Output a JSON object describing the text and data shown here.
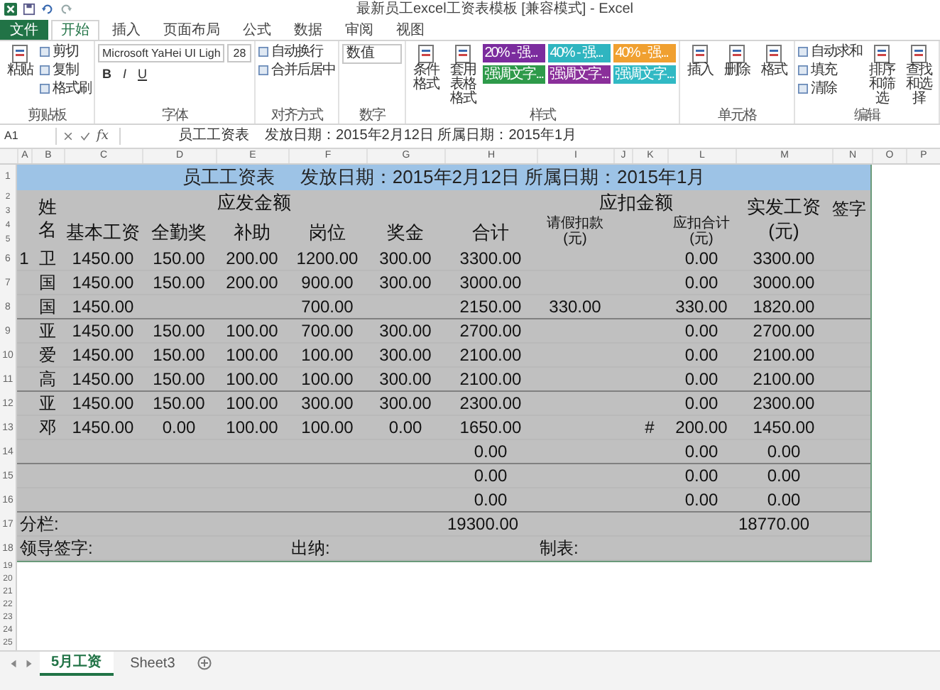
{
  "window": {
    "title": "最新员工excel工资表模板 [兼容模式] - Excel"
  },
  "ribbon": {
    "tabs": [
      {
        "label": "文件",
        "kind": "file",
        "selected": false
      },
      {
        "label": "开始",
        "kind": "tab",
        "selected": true
      },
      {
        "label": "插入",
        "kind": "tab",
        "selected": false
      },
      {
        "label": "页面布局",
        "kind": "tab",
        "selected": false
      },
      {
        "label": "公式",
        "kind": "tab",
        "selected": false
      },
      {
        "label": "数据",
        "kind": "tab",
        "selected": false
      },
      {
        "label": "审阅",
        "kind": "tab",
        "selected": false
      },
      {
        "label": "视图",
        "kind": "tab",
        "selected": false
      }
    ],
    "groups": [
      {
        "label": "剪贴板",
        "items": [
          {
            "kind": "big",
            "label": "粘贴"
          },
          {
            "kind": "stack",
            "labels": [
              "剪切",
              "复制",
              "格式刷"
            ]
          }
        ]
      },
      {
        "label": "字体",
        "items": [
          {
            "kind": "font",
            "font": "Microsoft YaHei UI Ligh",
            "size": "28",
            "glyphs": [
              "B",
              "I",
              "U"
            ]
          }
        ]
      },
      {
        "label": "对齐方式",
        "items": [
          {
            "kind": "stack",
            "labels": [
              "自动换行",
              "合并后居中"
            ]
          }
        ]
      },
      {
        "label": "数字",
        "items": [
          {
            "kind": "select",
            "value": "数值"
          }
        ]
      },
      {
        "label": "样式",
        "items": [
          {
            "kind": "big",
            "label": "条件格式"
          },
          {
            "kind": "big",
            "label": "套用表格格式"
          },
          {
            "kind": "swatches",
            "swatches": [
              {
                "label": "20% - 强...",
                "color": "#7b2c9e"
              },
              {
                "label": "40% - 强...",
                "color": "#2fb5c0"
              },
              {
                "label": "40% - 强...",
                "color": "#f0a030"
              },
              {
                "label": "强调文字...",
                "color": "#2e9a4a"
              },
              {
                "label": "强调文字...",
                "color": "#8a2f9a"
              },
              {
                "label": "强调文字...",
                "color": "#31b9c4"
              }
            ]
          }
        ]
      },
      {
        "label": "单元格",
        "items": [
          {
            "kind": "big",
            "label": "插入"
          },
          {
            "kind": "big",
            "label": "删除"
          },
          {
            "kind": "big",
            "label": "格式"
          }
        ]
      },
      {
        "label": "编辑",
        "items": [
          {
            "kind": "stack",
            "labels": [
              "自动求和",
              "填充",
              "清除"
            ]
          },
          {
            "kind": "big",
            "label": "排序和筛选"
          },
          {
            "kind": "big",
            "label": "查找和选择"
          }
        ]
      }
    ]
  },
  "formula_bar": {
    "cell": "A1",
    "fx": "fx",
    "content": "员工工资表    发放日期：2015年2月12日 所属日期：2015年1月"
  },
  "sheet": {
    "columns": [
      "A",
      "B",
      "C",
      "D",
      "E",
      "F",
      "G",
      "H",
      "I",
      "J",
      "K",
      "L",
      "M",
      "N",
      "O",
      "P"
    ],
    "title_row": {
      "number": "1",
      "text": "员工工资表     发放日期：2015年2月12日 所属日期：2015年1月"
    },
    "header": {
      "row_numbers": [
        "2",
        "3",
        "4",
        "5"
      ],
      "name": "姓名",
      "earnings": {
        "label": "应发金额",
        "columns": [
          "基本工资",
          "全勤奖",
          "补助",
          "岗位",
          "奖金"
        ]
      },
      "total": "合计",
      "deductions": {
        "label": "应扣金额",
        "columns": [
          "请假扣款(元)",
          "应扣合计(元)"
        ]
      },
      "net": "实发工资(元)",
      "sign": "签字"
    },
    "rows": [
      {
        "number": "6",
        "kind": "data",
        "divider": false,
        "cells": {
          "A": "1",
          "B": "卫",
          "C": "1450.00",
          "D": "150.00",
          "E": "200.00",
          "F": "1200.00",
          "G": "300.00",
          "H": "3300.00",
          "L": "0.00",
          "M": "3300.00"
        }
      },
      {
        "number": "7",
        "kind": "data",
        "divider": false,
        "cells": {
          "B": "国",
          "C": "1450.00",
          "D": "150.00",
          "E": "200.00",
          "F": "900.00",
          "G": "300.00",
          "H": "3000.00",
          "L": "0.00",
          "M": "3000.00"
        }
      },
      {
        "number": "8",
        "kind": "data",
        "divider": true,
        "cells": {
          "B": "国",
          "C": "1450.00",
          "F": "700.00",
          "H": "2150.00",
          "I": "330.00",
          "L": "330.00",
          "M": "1820.00"
        }
      },
      {
        "number": "9",
        "kind": "data",
        "divider": false,
        "cells": {
          "B": "亚",
          "C": "1450.00",
          "D": "150.00",
          "E": "100.00",
          "F": "700.00",
          "G": "300.00",
          "H": "2700.00",
          "L": "0.00",
          "M": "2700.00"
        }
      },
      {
        "number": "10",
        "kind": "data",
        "divider": false,
        "cells": {
          "B": "爱",
          "C": "1450.00",
          "D": "150.00",
          "E": "100.00",
          "F": "100.00",
          "G": "300.00",
          "H": "2100.00",
          "L": "0.00",
          "M": "2100.00"
        }
      },
      {
        "number": "11",
        "kind": "data",
        "divider": true,
        "cells": {
          "B": "高",
          "C": "1450.00",
          "D": "150.00",
          "E": "100.00",
          "F": "100.00",
          "G": "300.00",
          "H": "2100.00",
          "L": "0.00",
          "M": "2100.00"
        }
      },
      {
        "number": "12",
        "kind": "data",
        "divider": false,
        "cells": {
          "B": "亚",
          "C": "1450.00",
          "D": "150.00",
          "E": "100.00",
          "F": "300.00",
          "G": "300.00",
          "H": "2300.00",
          "L": "0.00",
          "M": "2300.00"
        }
      },
      {
        "number": "13",
        "kind": "data",
        "divider": false,
        "cells": {
          "B": "邓",
          "C": "1450.00",
          "D": "0.00",
          "E": "100.00",
          "F": "100.00",
          "G": "0.00",
          "H": "1650.00",
          "K": "#",
          "L": "200.00",
          "M": "1450.00"
        }
      },
      {
        "number": "14",
        "kind": "data",
        "divider": true,
        "cells": {
          "H": "0.00",
          "L": "0.00",
          "M": "0.00"
        }
      },
      {
        "number": "15",
        "kind": "data",
        "divider": false,
        "cells": {
          "H": "0.00",
          "L": "0.00",
          "M": "0.00"
        }
      },
      {
        "number": "16",
        "kind": "data",
        "divider": true,
        "cells": {
          "H": "0.00",
          "L": "0.00",
          "M": "0.00"
        }
      },
      {
        "number": "17",
        "kind": "footer",
        "divider": false,
        "cells": {
          "A": "分栏:",
          "H": "19300.00",
          "M": "18770.00"
        }
      },
      {
        "number": "18",
        "kind": "footer",
        "divider": false,
        "cells": {
          "A": "领导签字:",
          "F": "出纳:",
          "I": "制表:"
        }
      }
    ],
    "empty_rows": [
      "19",
      "20",
      "21",
      "22",
      "23",
      "24",
      "25"
    ]
  },
  "sheet_tabs": [
    {
      "label": "5月工资",
      "selected": true
    },
    {
      "label": "Sheet3",
      "selected": false
    }
  ]
}
